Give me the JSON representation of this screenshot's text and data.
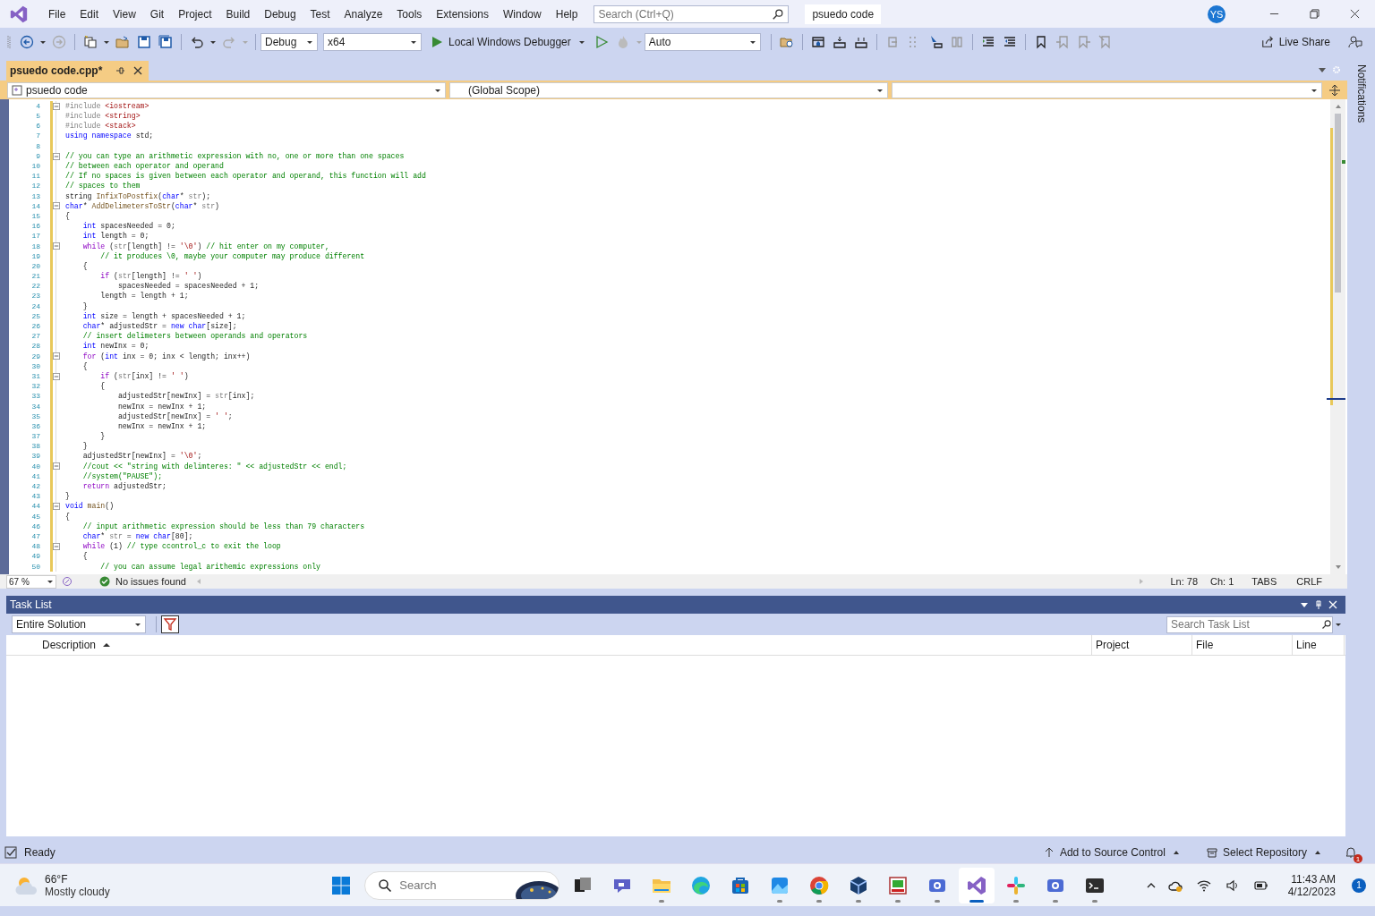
{
  "menu": [
    "File",
    "Edit",
    "View",
    "Git",
    "Project",
    "Build",
    "Debug",
    "Test",
    "Analyze",
    "Tools",
    "Extensions",
    "Window",
    "Help"
  ],
  "search": {
    "placeholder": "Search (Ctrl+Q)"
  },
  "solution_name": "psuedo code",
  "user_initials": "YS",
  "toolbar": {
    "configuration": "Debug",
    "platform": "x64",
    "run": "Local Windows Debugger",
    "solution_config": "Auto",
    "live_share": "Live Share"
  },
  "document_tabs": [
    {
      "label": "psuedo code.cpp*",
      "selected": true
    }
  ],
  "side_strip": "Notifications",
  "navigation": {
    "project": "psuedo code",
    "scope": "(Global Scope)"
  },
  "editor": {
    "lines": [
      {
        "n": "4",
        "fold": true,
        "tokens": [
          {
            "kind": "pp",
            "text": "#include "
          },
          {
            "kind": "str",
            "text": "<iostream>"
          }
        ]
      },
      {
        "n": "5",
        "fold": false,
        "tokens": [
          {
            "kind": "pp",
            "text": "#include "
          },
          {
            "kind": "str",
            "text": "<string>"
          }
        ]
      },
      {
        "n": "6",
        "fold": false,
        "tokens": [
          {
            "kind": "pp",
            "text": "#include "
          },
          {
            "kind": "str",
            "text": "<stack>"
          }
        ]
      },
      {
        "n": "7",
        "fold": false,
        "tokens": [
          {
            "kind": "kw",
            "text": "using namespace "
          },
          {
            "kind": "tx",
            "text": "std;"
          }
        ]
      },
      {
        "n": "8",
        "fold": false
      },
      {
        "n": "9",
        "fold": true,
        "tokens": [
          {
            "kind": "cm",
            "text": "// you can type an arithmetic expression with no, one or more than one spaces"
          }
        ]
      },
      {
        "n": "10",
        "fold": false,
        "tokens": [
          {
            "kind": "cm",
            "text": "// between each operator and operand"
          }
        ]
      },
      {
        "n": "11",
        "fold": false,
        "tokens": [
          {
            "kind": "cm",
            "text": "// If no spaces is given between each operator and operand, this function will add"
          }
        ]
      },
      {
        "n": "12",
        "fold": false,
        "tokens": [
          {
            "kind": "cm",
            "text": "// spaces to them"
          }
        ]
      },
      {
        "n": "13",
        "fold": false,
        "tokens": [
          {
            "kind": "tx",
            "text": "string "
          },
          {
            "kind": "fn",
            "text": "InfixToPostfix"
          },
          {
            "kind": "tx",
            "text": "("
          },
          {
            "kind": "kw",
            "text": "char"
          },
          {
            "kind": "tx",
            "text": "* "
          },
          {
            "kind": "pr",
            "text": "str"
          },
          {
            "kind": "tx",
            "text": ");"
          }
        ]
      },
      {
        "n": "14",
        "fold": true,
        "tokens": [
          {
            "kind": "kw",
            "text": "char"
          },
          {
            "kind": "tx",
            "text": "* "
          },
          {
            "kind": "fn",
            "text": "AddDelimetersToStr"
          },
          {
            "kind": "tx",
            "text": "("
          },
          {
            "kind": "kw",
            "text": "char"
          },
          {
            "kind": "tx",
            "text": "* "
          },
          {
            "kind": "pr",
            "text": "str"
          },
          {
            "kind": "tx",
            "text": ")"
          }
        ]
      },
      {
        "n": "15",
        "fold": false,
        "tokens": [
          {
            "kind": "tx",
            "text": "{"
          }
        ]
      },
      {
        "n": "16",
        "fold": false,
        "tokens": [
          {
            "kind": "kw",
            "text": "    int "
          },
          {
            "kind": "tx",
            "text": "spacesNeeded = 0;"
          }
        ]
      },
      {
        "n": "17",
        "fold": false,
        "tokens": [
          {
            "kind": "kw",
            "text": "    int "
          },
          {
            "kind": "tx",
            "text": "length = 0;"
          }
        ]
      },
      {
        "n": "18",
        "fold": true,
        "tokens": [
          {
            "kind": "ctl",
            "text": "    while "
          },
          {
            "kind": "tx",
            "text": "("
          },
          {
            "kind": "pr",
            "text": "str"
          },
          {
            "kind": "tx",
            "text": "[length] != "
          },
          {
            "kind": "str",
            "text": "'\\0'"
          },
          {
            "kind": "tx",
            "text": ") "
          },
          {
            "kind": "cm",
            "text": "// hit enter on my computer,"
          }
        ]
      },
      {
        "n": "19",
        "fold": false,
        "tokens": [
          {
            "kind": "cm",
            "text": "        // it produces \\0, maybe your computer may produce different"
          }
        ]
      },
      {
        "n": "20",
        "fold": false,
        "tokens": [
          {
            "kind": "tx",
            "text": "    {"
          }
        ]
      },
      {
        "n": "21",
        "fold": false,
        "tokens": [
          {
            "kind": "ctl",
            "text": "        if "
          },
          {
            "kind": "tx",
            "text": "("
          },
          {
            "kind": "pr",
            "text": "str"
          },
          {
            "kind": "tx",
            "text": "[length] != "
          },
          {
            "kind": "str",
            "text": "' '"
          },
          {
            "kind": "tx",
            "text": ")"
          }
        ]
      },
      {
        "n": "22",
        "fold": false,
        "tokens": [
          {
            "kind": "tx",
            "text": "            spacesNeeded = spacesNeeded + 1;"
          }
        ]
      },
      {
        "n": "23",
        "fold": false,
        "tokens": [
          {
            "kind": "tx",
            "text": "        length = length + 1;"
          }
        ]
      },
      {
        "n": "24",
        "fold": false,
        "tokens": [
          {
            "kind": "tx",
            "text": "    }"
          }
        ]
      },
      {
        "n": "25",
        "fold": false,
        "tokens": [
          {
            "kind": "kw",
            "text": "    int "
          },
          {
            "kind": "tx",
            "text": "size = length + spacesNeeded + 1;"
          }
        ]
      },
      {
        "n": "26",
        "fold": false,
        "tokens": [
          {
            "kind": "kw",
            "text": "    char"
          },
          {
            "kind": "tx",
            "text": "* adjustedStr = "
          },
          {
            "kind": "kw",
            "text": "new char"
          },
          {
            "kind": "tx",
            "text": "[size];"
          }
        ]
      },
      {
        "n": "27",
        "fold": false,
        "tokens": [
          {
            "kind": "cm",
            "text": "    // insert delimeters between operands and operators"
          }
        ]
      },
      {
        "n": "28",
        "fold": false,
        "tokens": [
          {
            "kind": "kw",
            "text": "    int "
          },
          {
            "kind": "tx",
            "text": "newInx = 0;"
          }
        ]
      },
      {
        "n": "29",
        "fold": true,
        "tokens": [
          {
            "kind": "ctl",
            "text": "    for "
          },
          {
            "kind": "tx",
            "text": "("
          },
          {
            "kind": "kw",
            "text": "int "
          },
          {
            "kind": "tx",
            "text": "inx = 0; inx < length; inx++)"
          }
        ]
      },
      {
        "n": "30",
        "fold": false,
        "tokens": [
          {
            "kind": "tx",
            "text": "    {"
          }
        ]
      },
      {
        "n": "31",
        "fold": true,
        "tokens": [
          {
            "kind": "ctl",
            "text": "        if "
          },
          {
            "kind": "tx",
            "text": "("
          },
          {
            "kind": "pr",
            "text": "str"
          },
          {
            "kind": "tx",
            "text": "[inx] != "
          },
          {
            "kind": "str",
            "text": "' '"
          },
          {
            "kind": "tx",
            "text": ")"
          }
        ]
      },
      {
        "n": "32",
        "fold": false,
        "tokens": [
          {
            "kind": "tx",
            "text": "        {"
          }
        ]
      },
      {
        "n": "33",
        "fold": false,
        "tokens": [
          {
            "kind": "tx",
            "text": "            adjustedStr[newInx] = "
          },
          {
            "kind": "pr",
            "text": "str"
          },
          {
            "kind": "tx",
            "text": "[inx];"
          }
        ]
      },
      {
        "n": "34",
        "fold": false,
        "tokens": [
          {
            "kind": "tx",
            "text": "            newInx = newInx + 1;"
          }
        ]
      },
      {
        "n": "35",
        "fold": false,
        "tokens": [
          {
            "kind": "tx",
            "text": "            adjustedStr[newInx] = "
          },
          {
            "kind": "str",
            "text": "' '"
          },
          {
            "kind": "tx",
            "text": ";"
          }
        ]
      },
      {
        "n": "36",
        "fold": false,
        "tokens": [
          {
            "kind": "tx",
            "text": "            newInx = newInx + 1;"
          }
        ]
      },
      {
        "n": "37",
        "fold": false,
        "tokens": [
          {
            "kind": "tx",
            "text": "        }"
          }
        ]
      },
      {
        "n": "38",
        "fold": false,
        "tokens": [
          {
            "kind": "tx",
            "text": "    }"
          }
        ]
      },
      {
        "n": "39",
        "fold": false,
        "tokens": [
          {
            "kind": "tx",
            "text": "    adjustedStr[newInx] = "
          },
          {
            "kind": "str",
            "text": "'\\0'"
          },
          {
            "kind": "tx",
            "text": ";"
          }
        ]
      },
      {
        "n": "40",
        "fold": true,
        "tokens": [
          {
            "kind": "cm",
            "text": "    //cout << \"string with delimteres: \" << adjustedStr << endl;"
          }
        ]
      },
      {
        "n": "41",
        "fold": false,
        "tokens": [
          {
            "kind": "cm",
            "text": "    //system(\"PAUSE\");"
          }
        ]
      },
      {
        "n": "42",
        "fold": false,
        "tokens": [
          {
            "kind": "ctl",
            "text": "    return "
          },
          {
            "kind": "tx",
            "text": "adjustedStr;"
          }
        ]
      },
      {
        "n": "43",
        "fold": false,
        "tokens": [
          {
            "kind": "tx",
            "text": "}"
          }
        ]
      },
      {
        "n": "44",
        "fold": true,
        "tokens": [
          {
            "kind": "kw",
            "text": "void "
          },
          {
            "kind": "fn",
            "text": "main"
          },
          {
            "kind": "tx",
            "text": "()"
          }
        ]
      },
      {
        "n": "45",
        "fold": false,
        "tokens": [
          {
            "kind": "tx",
            "text": "{"
          }
        ]
      },
      {
        "n": "46",
        "fold": false,
        "tokens": [
          {
            "kind": "cm",
            "text": "    // input arithmetic expression should be less than 79 characters"
          }
        ]
      },
      {
        "n": "47",
        "fold": false,
        "tokens": [
          {
            "kind": "kw",
            "text": "    char"
          },
          {
            "kind": "tx",
            "text": "* "
          },
          {
            "kind": "pr",
            "text": "str"
          },
          {
            "kind": "tx",
            "text": " = "
          },
          {
            "kind": "kw",
            "text": "new char"
          },
          {
            "kind": "tx",
            "text": "[80];"
          }
        ]
      },
      {
        "n": "48",
        "fold": true,
        "tokens": [
          {
            "kind": "ctl",
            "text": "    while "
          },
          {
            "kind": "tx",
            "text": "(1) "
          },
          {
            "kind": "cm",
            "text": "// type ccontrol_c to exit the loop"
          }
        ]
      },
      {
        "n": "49",
        "fold": false,
        "tokens": [
          {
            "kind": "tx",
            "text": "    {"
          }
        ]
      },
      {
        "n": "50",
        "fold": false,
        "tokens": [
          {
            "kind": "cm",
            "text": "        // you can assume legal arithemic expressions only"
          }
        ]
      }
    ]
  },
  "editor_status": {
    "zoom": "67 %",
    "issues": "No issues found",
    "line": "Ln: 78",
    "column": "Ch: 1",
    "indent": "TABS",
    "line_ending": "CRLF"
  },
  "task_list": {
    "title": "Task List",
    "scope": "Entire Solution",
    "search": {
      "placeholder": "Search Task List"
    },
    "columns": [
      {
        "label": "Description",
        "sorted": true
      },
      {
        "label": "Project",
        "sorted": false
      },
      {
        "label": "File",
        "sorted": false
      },
      {
        "label": "Line",
        "sorted": false
      }
    ]
  },
  "status_bar": {
    "text": "Ready",
    "source_control": "Add to Source Control",
    "repository": "Select Repository",
    "notifications": "1"
  },
  "taskbar": {
    "weather": {
      "temp": "66°F",
      "condition": "Mostly cloudy"
    },
    "search": {
      "placeholder": "Search"
    },
    "apps": [
      {
        "kind": "taskview",
        "running": false,
        "selected": false
      },
      {
        "kind": "chat",
        "running": false,
        "selected": false
      },
      {
        "kind": "folder",
        "running": true,
        "selected": false
      },
      {
        "kind": "edge",
        "running": false,
        "selected": false
      },
      {
        "kind": "store",
        "running": false,
        "selected": false
      },
      {
        "kind": "photos",
        "running": true,
        "selected": false
      },
      {
        "kind": "chrome",
        "running": true,
        "selected": false
      },
      {
        "kind": "cube",
        "running": true,
        "selected": false
      },
      {
        "kind": "tool",
        "running": true,
        "selected": false
      },
      {
        "kind": "camera",
        "running": true,
        "selected": false
      },
      {
        "kind": "vs",
        "running": true,
        "selected": true
      },
      {
        "kind": "slack",
        "running": true,
        "selected": false
      },
      {
        "kind": "camera",
        "running": true,
        "selected": false
      },
      {
        "kind": "terminal",
        "running": true,
        "selected": false
      }
    ],
    "time": "11:43 AM",
    "date": "4/12/2023",
    "badge": "1"
  }
}
